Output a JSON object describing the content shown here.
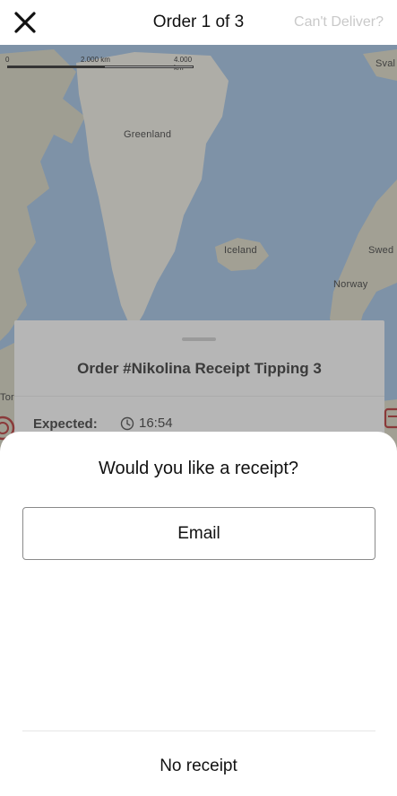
{
  "header": {
    "title": "Order 1 of 3",
    "cant_deliver": "Can't Deliver?"
  },
  "map": {
    "scale": {
      "zero": "0",
      "mid": "2.000 km",
      "max": "4.000 km"
    },
    "labels": {
      "greenland": "Greenland",
      "iceland": "Iceland",
      "norway": "Norway",
      "sweden": "Swed",
      "svalbard": "Sval",
      "toronto": "Tor"
    }
  },
  "order_card": {
    "title": "Order #Nikolina Receipt Tipping 3",
    "expected_label": "Expected:",
    "expected_time": "16:54"
  },
  "sheet": {
    "title": "Would you like a receipt?",
    "email_label": "Email",
    "no_receipt_label": "No receipt"
  }
}
